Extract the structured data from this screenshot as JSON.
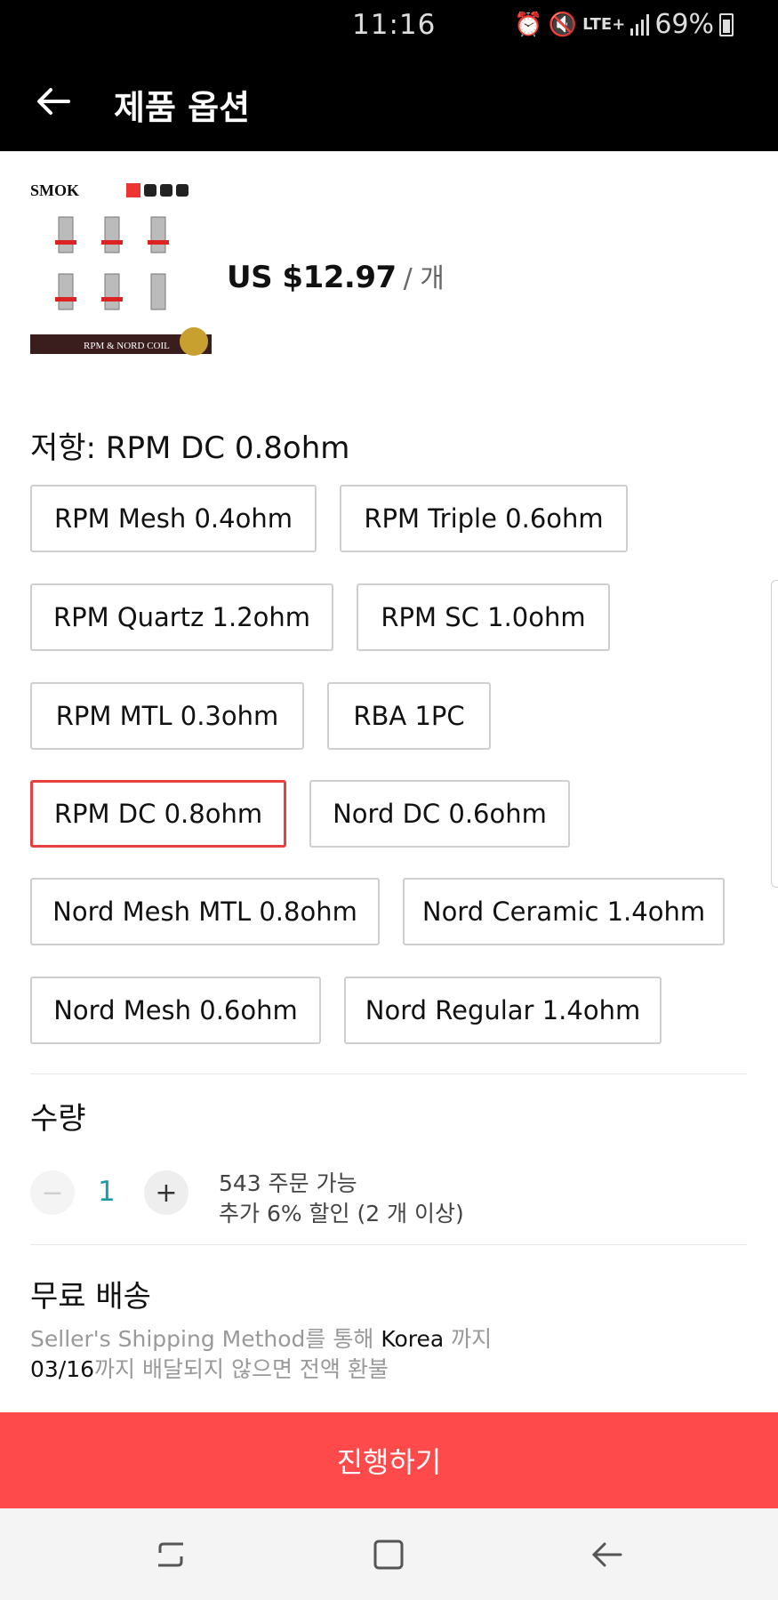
{
  "status_bar": {
    "time": "11:16",
    "battery": "69%",
    "network": "LTE+"
  },
  "header": {
    "title": "제품 옵션",
    "back_icon": "back-arrow-icon"
  },
  "product": {
    "image_brand_text": "SMOK",
    "image_banner_text": "RPM & NORD COIL",
    "price": "US $12.97",
    "price_unit": "/ 개"
  },
  "options": {
    "title": "저항: RPM DC 0.8ohm",
    "selected_index": 6,
    "items": [
      "RPM Mesh 0.4ohm",
      "RPM Triple 0.6ohm",
      "RPM Quartz 1.2ohm",
      "RPM SC 1.0ohm",
      "RPM MTL 0.3ohm",
      "RBA 1PC",
      "RPM DC 0.8ohm",
      "Nord DC 0.6ohm",
      "Nord Mesh MTL 0.8ohm",
      "Nord Ceramic 1.4ohm",
      "Nord Mesh 0.6ohm",
      "Nord Regular 1.4ohm"
    ]
  },
  "quantity": {
    "title": "수량",
    "minus": "−",
    "value": "1",
    "plus": "+",
    "stock": "543 주문 가능",
    "discount": "추가 6% 할인 (2 개 이상)"
  },
  "shipping": {
    "title": "무료 배송",
    "method": "Seller's Shipping Method",
    "via": "를 통해",
    "country": "Korea",
    "to": "까지",
    "date": "03/16",
    "guarantee": "까지 배달되지 않으면 전액 환불"
  },
  "actions": {
    "proceed_label": "진행하기"
  },
  "colors": {
    "accent": "#ff4a4c",
    "selected_border": "#e8403f",
    "quantity_value": "#1f9aa9",
    "header_bg": "#000000"
  }
}
